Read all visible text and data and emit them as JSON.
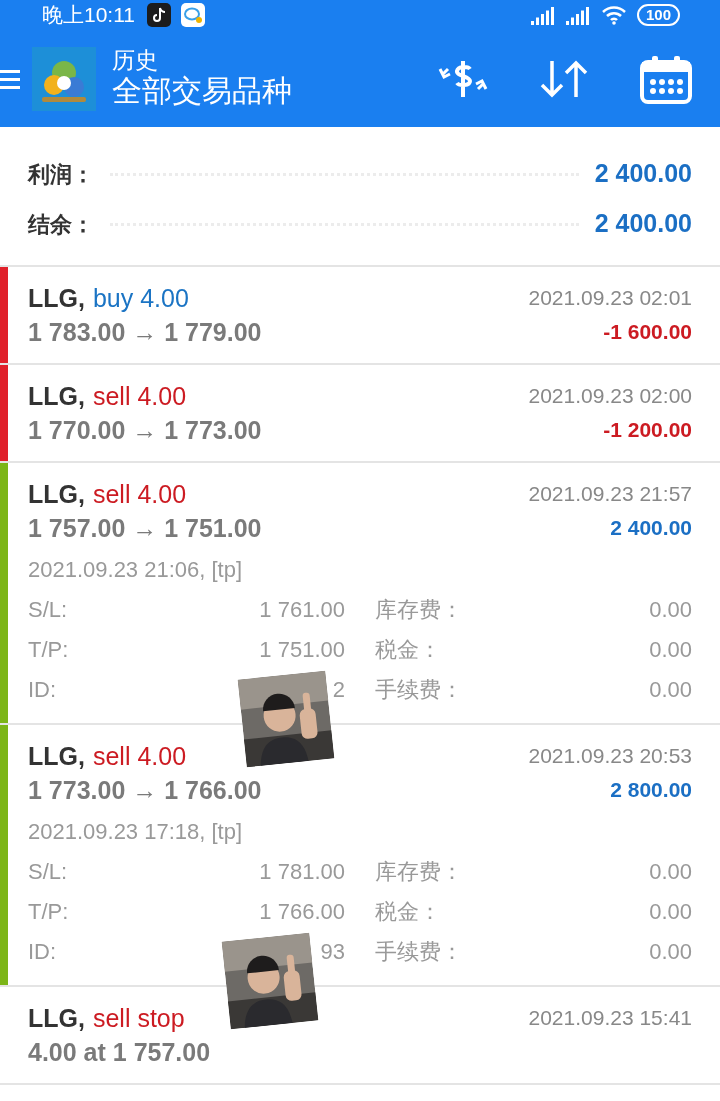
{
  "status_bar": {
    "time": "晚上10:11",
    "battery": "100"
  },
  "app_bar": {
    "title": "历史",
    "subtitle": "全部交易品种"
  },
  "summary": [
    {
      "label": "利润：",
      "value": "2 400.00"
    },
    {
      "label": "结余：",
      "value": "2 400.00"
    }
  ],
  "trades": [
    {
      "symbol": "LLG,",
      "color": "#e0202a",
      "action": {
        "text": "buy 4.00",
        "color": "#1b74c4"
      },
      "time": "2021.09.23 02:01",
      "prices": "1 783.00 → 1 779.00",
      "profit": {
        "text": "-1 600.00",
        "color": "#cc1b22"
      }
    },
    {
      "symbol": "LLG,",
      "color": "#e0202a",
      "action": {
        "text": "sell 4.00",
        "color": "#cc1b22"
      },
      "time": "2021.09.23 02:00",
      "prices": "1 770.00 → 1 773.00",
      "profit": {
        "text": "-1 200.00",
        "color": "#cc1b22"
      }
    },
    {
      "symbol": "LLG,",
      "color": "#7cb518",
      "action": {
        "text": "sell 4.00",
        "color": "#cc1b22"
      },
      "time": "2021.09.23 21:57",
      "prices": "1 757.00 → 1 751.00",
      "profit": {
        "text": "2 400.00",
        "color": "#1b6fc4"
      },
      "details": {
        "open_time": "2021.09.23 21:06, [tp]",
        "fields": [
          {
            "label": "S/L:",
            "value": "1 761.00"
          },
          {
            "label": "库存费：",
            "value": "0.00"
          },
          {
            "label": "T/P:",
            "value": "1 751.00"
          },
          {
            "label": "税金：",
            "value": "0.00"
          },
          {
            "label": "ID:",
            "value": "2"
          },
          {
            "label": "手续费：",
            "value": "0.00"
          }
        ]
      }
    },
    {
      "symbol": "LLG,",
      "color": "#7cb518",
      "action": {
        "text": "sell 4.00",
        "color": "#cc1b22"
      },
      "time": "2021.09.23 20:53",
      "prices": "1 773.00 → 1 766.00",
      "profit": {
        "text": "2 800.00",
        "color": "#1b6fc4"
      },
      "details": {
        "open_time": "2021.09.23 17:18, [tp]",
        "fields": [
          {
            "label": "S/L:",
            "value": "1 781.00"
          },
          {
            "label": "库存费：",
            "value": "0.00"
          },
          {
            "label": "T/P:",
            "value": "1 766.00"
          },
          {
            "label": "税金：",
            "value": "0.00"
          },
          {
            "label": "ID:",
            "value": "93"
          },
          {
            "label": "手续费：",
            "value": "0.00"
          }
        ]
      }
    },
    {
      "symbol": "LLG,",
      "action": {
        "text": "sell stop",
        "color": "#cc1b22"
      },
      "time": "2021.09.23 15:41",
      "prices": "4.00 at 1 757.00"
    }
  ]
}
